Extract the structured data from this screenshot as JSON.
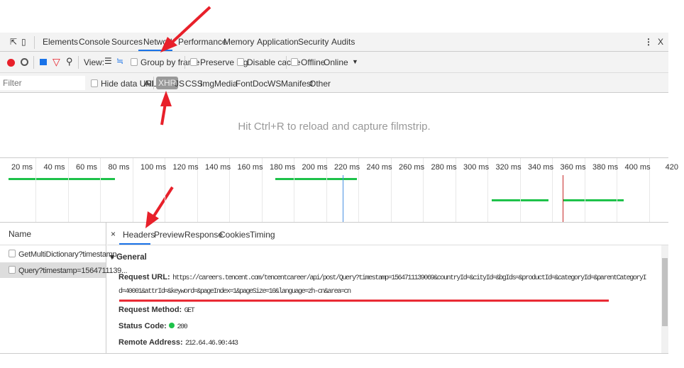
{
  "devtools": {
    "tabs": [
      "Elements",
      "Console",
      "Sources",
      "Network",
      "Performance",
      "Memory",
      "Application",
      "Security",
      "Audits"
    ],
    "active_tab": "Network",
    "close_label": "X",
    "more_label": "⋮"
  },
  "toolbar": {
    "view_label": "View:",
    "group_by_frame": "Group by frame",
    "preserve_log": "Preserve log",
    "disable_cache": "Disable cache",
    "offline": "Offline",
    "throttle": "Online",
    "throttle_arrow": "▼"
  },
  "filter_bar": {
    "placeholder": "Filter",
    "hide_data_urls": "Hide data URLs",
    "types": [
      "All",
      "XHR",
      "JS",
      "CSS",
      "Img",
      "Media",
      "Font",
      "Doc",
      "WS",
      "Manifest",
      "Other"
    ],
    "active_type": "XHR"
  },
  "filmstrip_hint": "Hit Ctrl+R to reload and capture filmstrip.",
  "timeline": {
    "ticks": [
      "20 ms",
      "40 ms",
      "60 ms",
      "80 ms",
      "100 ms",
      "120 ms",
      "140 ms",
      "160 ms",
      "180 ms",
      "200 ms",
      "220 ms",
      "240 ms",
      "260 ms",
      "280 ms",
      "300 ms",
      "320 ms",
      "340 ms",
      "360 ms",
      "380 ms",
      "400 ms",
      "420"
    ]
  },
  "requests": {
    "header": "Name",
    "items": [
      "GetMultiDictionary?timestamp...",
      "Query?timestamp=1564711139..."
    ],
    "selected": 1
  },
  "details": {
    "close": "×",
    "tabs": [
      "Headers",
      "Preview",
      "Response",
      "Cookies",
      "Timing"
    ],
    "active_tab": "Headers",
    "section": "General",
    "request_url_label": "Request URL:",
    "request_url_line1": "https://careers.tencent.com/tencentcareer/api/post/Query?timestamp=1564711139069&countryId=&cityId=&bgIds=&productId=&categoryId=&parentCategoryI",
    "request_url_line2": "d=40001&attrId=&keyword=&pageIndex=1&pageSize=10&language=zh-cn&area=cn",
    "method_label": "Request Method:",
    "method": "GET",
    "status_label": "Status Code:",
    "status": "200",
    "status_color": "#1ec24a",
    "remote_label": "Remote Address:",
    "remote": "212.64.46.90:443"
  },
  "colors": {
    "annotation": "#e8202a",
    "accent": "#1a73e8"
  }
}
